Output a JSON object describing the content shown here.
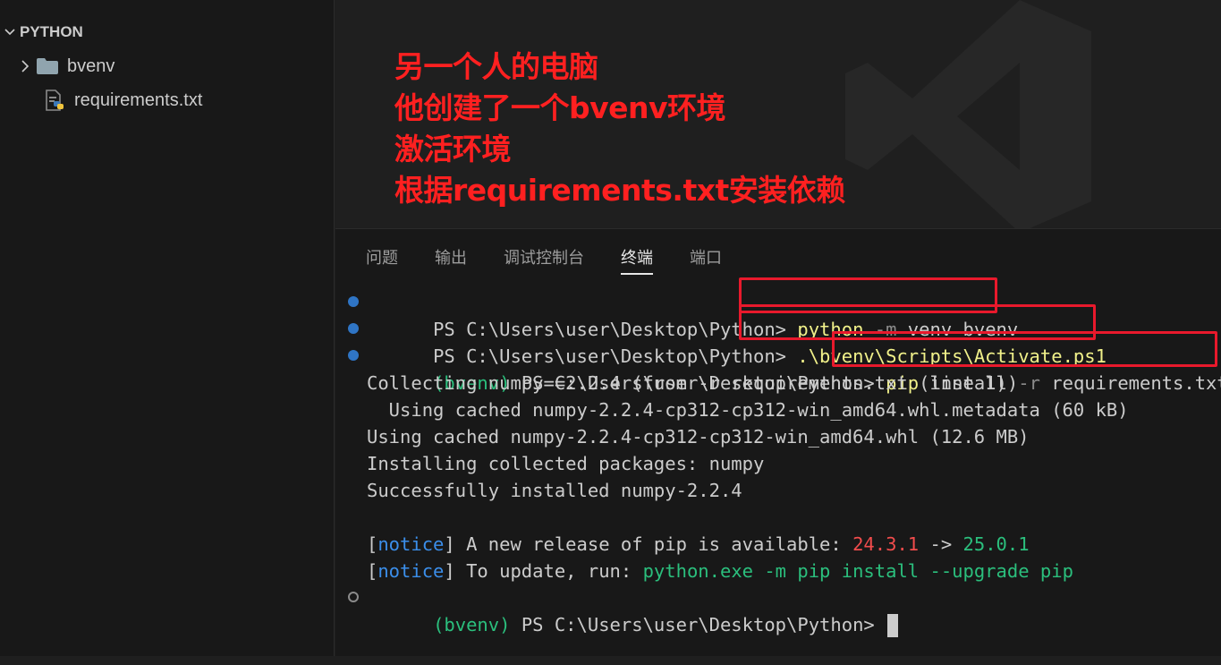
{
  "explorer": {
    "title": "PYTHON",
    "items": [
      {
        "label": "bvenv",
        "icon": "folder-icon"
      },
      {
        "label": "requirements.txt",
        "icon": "python-file-icon"
      }
    ]
  },
  "annotation": {
    "lines": [
      "另一个人的电脑",
      "他创建了一个bvenv环境",
      "激活环境",
      "根据requirements.txt安装依赖"
    ],
    "color": "#ff2020"
  },
  "panel": {
    "tabs": [
      "问题",
      "输出",
      "调试控制台",
      "终端",
      "端口"
    ],
    "active_tab": "终端"
  },
  "terminal": {
    "prompt": "PS C:\\Users\\user\\Desktop\\Python>",
    "venv_tag": "(bvenv)",
    "cmd1": {
      "a": "python",
      "b": "-m",
      "c": "venv bvenv"
    },
    "cmd2": ".\\bvenv\\Scripts\\Activate.ps1",
    "cmd3": {
      "a": "pip",
      "b": "install",
      "c": "-r",
      "d": "requirements.txt"
    },
    "out1": "Collecting numpy==2.2.4 (from -r requirements.txt (line 1))",
    "out2": "  Using cached numpy-2.2.4-cp312-cp312-win_amd64.whl.metadata (60 kB)",
    "out3": "Using cached numpy-2.2.4-cp312-cp312-win_amd64.whl (12.6 MB)",
    "out4": "Installing collected packages: numpy",
    "out5": "Successfully installed numpy-2.2.4",
    "notice_word": "notice",
    "notice1_text": " A new release of pip is available: ",
    "notice1_old": "24.3.1",
    "notice1_arrow": " -> ",
    "notice1_new": "25.0.1",
    "notice2_text": " To update, run: ",
    "notice2_cmd": "python.exe -m pip install --upgrade pip"
  }
}
